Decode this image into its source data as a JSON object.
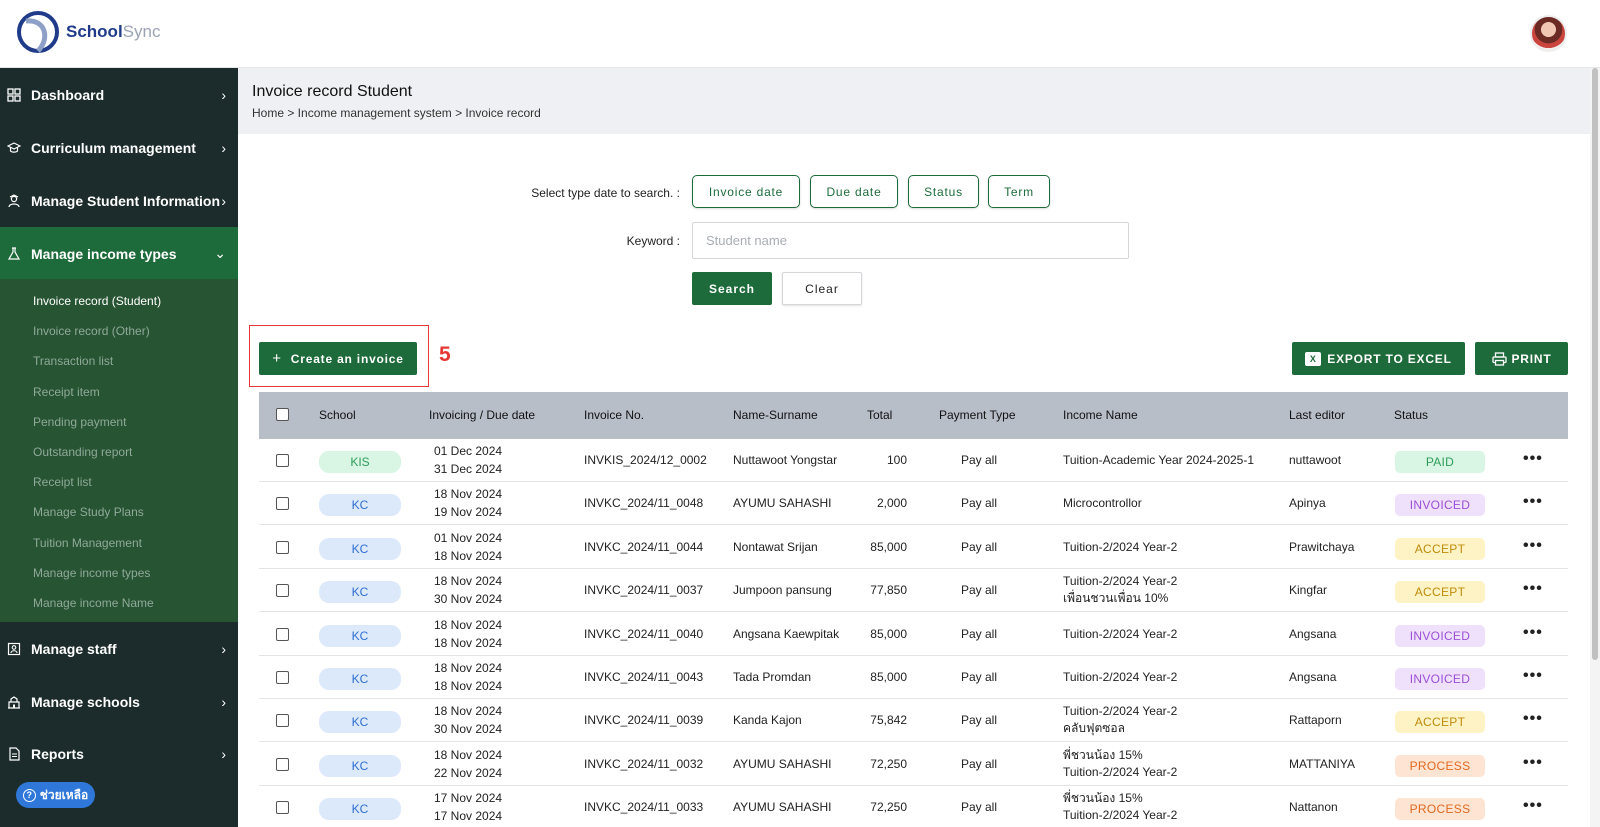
{
  "app": {
    "logo_primary": "School",
    "logo_secondary": "Sync"
  },
  "sidebar": {
    "items": [
      {
        "label": "Dashboard",
        "icon": "grid-icon"
      },
      {
        "label": "Curriculum management",
        "icon": "graduation-cap-icon"
      },
      {
        "label": "Manage Student Information",
        "icon": "student-icon"
      },
      {
        "label": "Manage income types",
        "icon": "flask-icon"
      },
      {
        "label": "Manage staff",
        "icon": "staff-icon"
      },
      {
        "label": "Manage schools",
        "icon": "school-icon"
      },
      {
        "label": "Reports",
        "icon": "report-icon"
      }
    ],
    "submenu": [
      "Invoice record (Student)",
      "Invoice record (Other)",
      "Transaction list",
      "Receipt item",
      "Pending payment",
      "Outstanding report",
      "Receipt list",
      "Manage Study Plans",
      "Tuition Management",
      "Manage income types",
      "Manage income Name"
    ],
    "help_label": "ช่วยเหลือ"
  },
  "header": {
    "title": "Invoice record Student",
    "breadcrumb": "Home > Income management system > Invoice record"
  },
  "search": {
    "type_label": "Select type date to search. :",
    "chips": [
      "Invoice date",
      "Due date",
      "Status",
      "Term"
    ],
    "keyword_label": "Keyword :",
    "keyword_placeholder": "Student name",
    "search_label": "Search",
    "clear_label": "Clear"
  },
  "actions": {
    "create_label": "Create an invoice",
    "step_number": "5",
    "excel_label": "EXPORT TO EXCEL",
    "print_label": "PRINT"
  },
  "table": {
    "columns": [
      "School",
      "Invoicing / Due date",
      "Invoice No.",
      "Name-Surname",
      "Total",
      "Payment Type",
      "Income Name",
      "Last editor",
      "Status"
    ],
    "rows": [
      {
        "school": "KIS",
        "invoice_date": "01 Dec 2024",
        "due_date": "31 Dec 2024",
        "invoice_no": "INVKIS_2024/12_0002",
        "name": "Nuttawoot Yongstar",
        "total": "100",
        "payment_type": "Pay all",
        "income_line1": "Tuition-Academic Year 2024-2025-1",
        "income_line2": "",
        "editor": "nuttawoot",
        "status": "PAID"
      },
      {
        "school": "KC",
        "invoice_date": "18 Nov 2024",
        "due_date": "19 Nov 2024",
        "invoice_no": "INVKC_2024/11_0048",
        "name": "AYUMU SAHASHI",
        "total": "2,000",
        "payment_type": "Pay all",
        "income_line1": "Microcontrollor",
        "income_line2": "",
        "editor": "Apinya",
        "status": "INVOICED"
      },
      {
        "school": "KC",
        "invoice_date": "01 Nov 2024",
        "due_date": "18 Nov 2024",
        "invoice_no": "INVKC_2024/11_0044",
        "name": "Nontawat Srijan",
        "total": "85,000",
        "payment_type": "Pay all",
        "income_line1": "Tuition-2/2024 Year-2",
        "income_line2": "",
        "editor": "Prawitchaya",
        "status": "ACCEPT"
      },
      {
        "school": "KC",
        "invoice_date": "18 Nov 2024",
        "due_date": "30 Nov 2024",
        "invoice_no": "INVKC_2024/11_0037",
        "name": "Jumpoon pansung",
        "total": "77,850",
        "payment_type": "Pay all",
        "income_line1": "Tuition-2/2024 Year-2",
        "income_line2": "เพื่อนชวนเพื่อน 10%",
        "editor": "Kingfar",
        "status": "ACCEPT"
      },
      {
        "school": "KC",
        "invoice_date": "18 Nov 2024",
        "due_date": "18 Nov 2024",
        "invoice_no": "INVKC_2024/11_0040",
        "name": "Angsana Kaewpitak",
        "total": "85,000",
        "payment_type": "Pay all",
        "income_line1": "Tuition-2/2024 Year-2",
        "income_line2": "",
        "editor": "Angsana",
        "status": "INVOICED"
      },
      {
        "school": "KC",
        "invoice_date": "18 Nov 2024",
        "due_date": "18 Nov 2024",
        "invoice_no": "INVKC_2024/11_0043",
        "name": "Tada Promdan",
        "total": "85,000",
        "payment_type": "Pay all",
        "income_line1": "Tuition-2/2024 Year-2",
        "income_line2": "",
        "editor": "Angsana",
        "status": "INVOICED"
      },
      {
        "school": "KC",
        "invoice_date": "18 Nov 2024",
        "due_date": "30 Nov 2024",
        "invoice_no": "INVKC_2024/11_0039",
        "name": "Kanda Kajon",
        "total": "75,842",
        "payment_type": "Pay all",
        "income_line1": "Tuition-2/2024 Year-2",
        "income_line2": "คลับฟุตซอล",
        "editor": "Rattaporn",
        "status": "ACCEPT"
      },
      {
        "school": "KC",
        "invoice_date": "18 Nov 2024",
        "due_date": "22 Nov 2024",
        "invoice_no": "INVKC_2024/11_0032",
        "name": "AYUMU SAHASHI",
        "total": "72,250",
        "payment_type": "Pay all",
        "income_line1": "พี่ชวนน้อง 15%",
        "income_line2": "Tuition-2/2024 Year-2",
        "editor": "MATTANIYA",
        "status": "PROCESS"
      },
      {
        "school": "KC",
        "invoice_date": "17 Nov 2024",
        "due_date": "17 Nov 2024",
        "invoice_no": "INVKC_2024/11_0033",
        "name": "AYUMU SAHASHI",
        "total": "72,250",
        "payment_type": "Pay all",
        "income_line1": "พี่ชวนน้อง 15%",
        "income_line2": "Tuition-2/2024 Year-2",
        "editor": "Nattanon",
        "status": "PROCESS"
      }
    ]
  },
  "colors": {
    "brand_green": "#1d6b3a",
    "sidebar_bg": "#1c2b2b",
    "status_paid_bg": "#d9f5e3",
    "status_paid_fg": "#2e9d5a",
    "status_invoiced_bg": "#efe0fb",
    "status_invoiced_fg": "#9b4fd6",
    "status_accept_bg": "#fdf3c4",
    "status_accept_fg": "#c18b0b",
    "status_process_bg": "#fde4d3",
    "status_process_fg": "#e2691f",
    "school_kis_bg": "#d9f5e3",
    "school_kis_fg": "#2e9d5a",
    "school_kc_bg": "#dce9fb",
    "school_kc_fg": "#2f6fd1"
  }
}
